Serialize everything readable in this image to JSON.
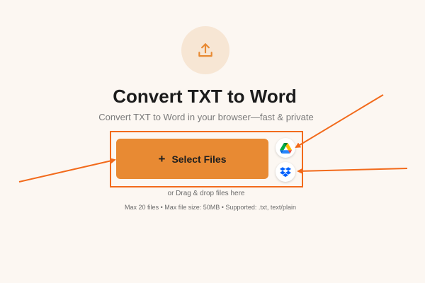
{
  "page": {
    "title": "Convert TXT to Word",
    "subtitle": "Convert TXT to Word in your browser—fast & private"
  },
  "uploader": {
    "select_files_label": "Select Files",
    "plus_symbol": "+",
    "drag_hint": "or Drag & drop files here",
    "limits": "Max 20 files • Max file size: 50MB • Supported: .txt, text/plain"
  },
  "icons": {
    "upload": "upload-icon",
    "google_drive": "google-drive-icon",
    "dropbox": "dropbox-icon"
  },
  "colors": {
    "background": "#fcf7f2",
    "accent": "#e88a33",
    "annotation": "#f26a1b",
    "dropbox_blue": "#0061fe"
  }
}
